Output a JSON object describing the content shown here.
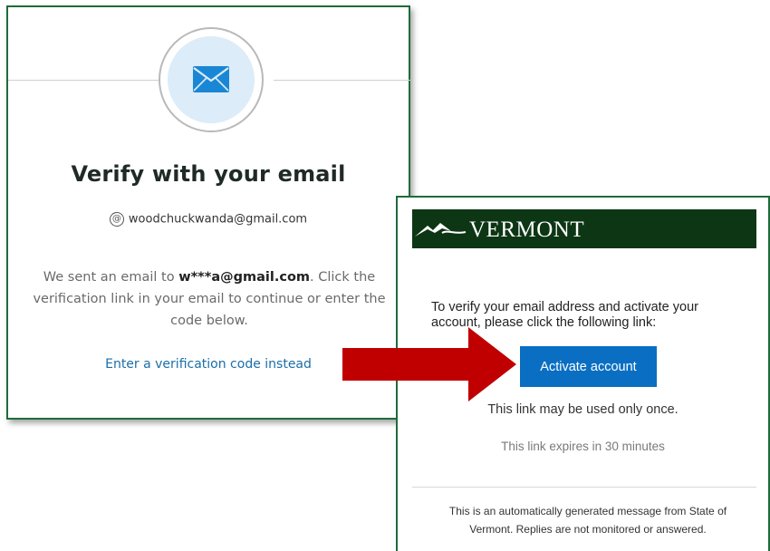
{
  "verify_panel": {
    "title": "Verify with your email",
    "email": "woodchuckwanda@gmail.com",
    "message_prefix": "We sent an email to ",
    "masked_email": "w***a@gmail.com",
    "message_suffix": ". Click the verification link in your email to continue or enter the code below.",
    "code_link": "Enter a verification code instead",
    "icons": {
      "mail": "envelope-icon",
      "account": "at-account-icon"
    }
  },
  "vermont_email": {
    "brand": "VERMONT",
    "instructions": "To verify your email address and activate your account, please click the following link:",
    "activate_button": "Activate account",
    "once_note": "This link may be used only once.",
    "expires_note": "This link expires in 30 minutes",
    "footer": "This is an automatically generated message from State of Vermont. Replies are not monitored or answered.",
    "colors": {
      "header_bg": "#0d3614",
      "button_bg": "#0a6fc2"
    }
  },
  "annotation": {
    "arrow_color": "#c00000",
    "arrow_icon": "right-arrow-icon"
  }
}
